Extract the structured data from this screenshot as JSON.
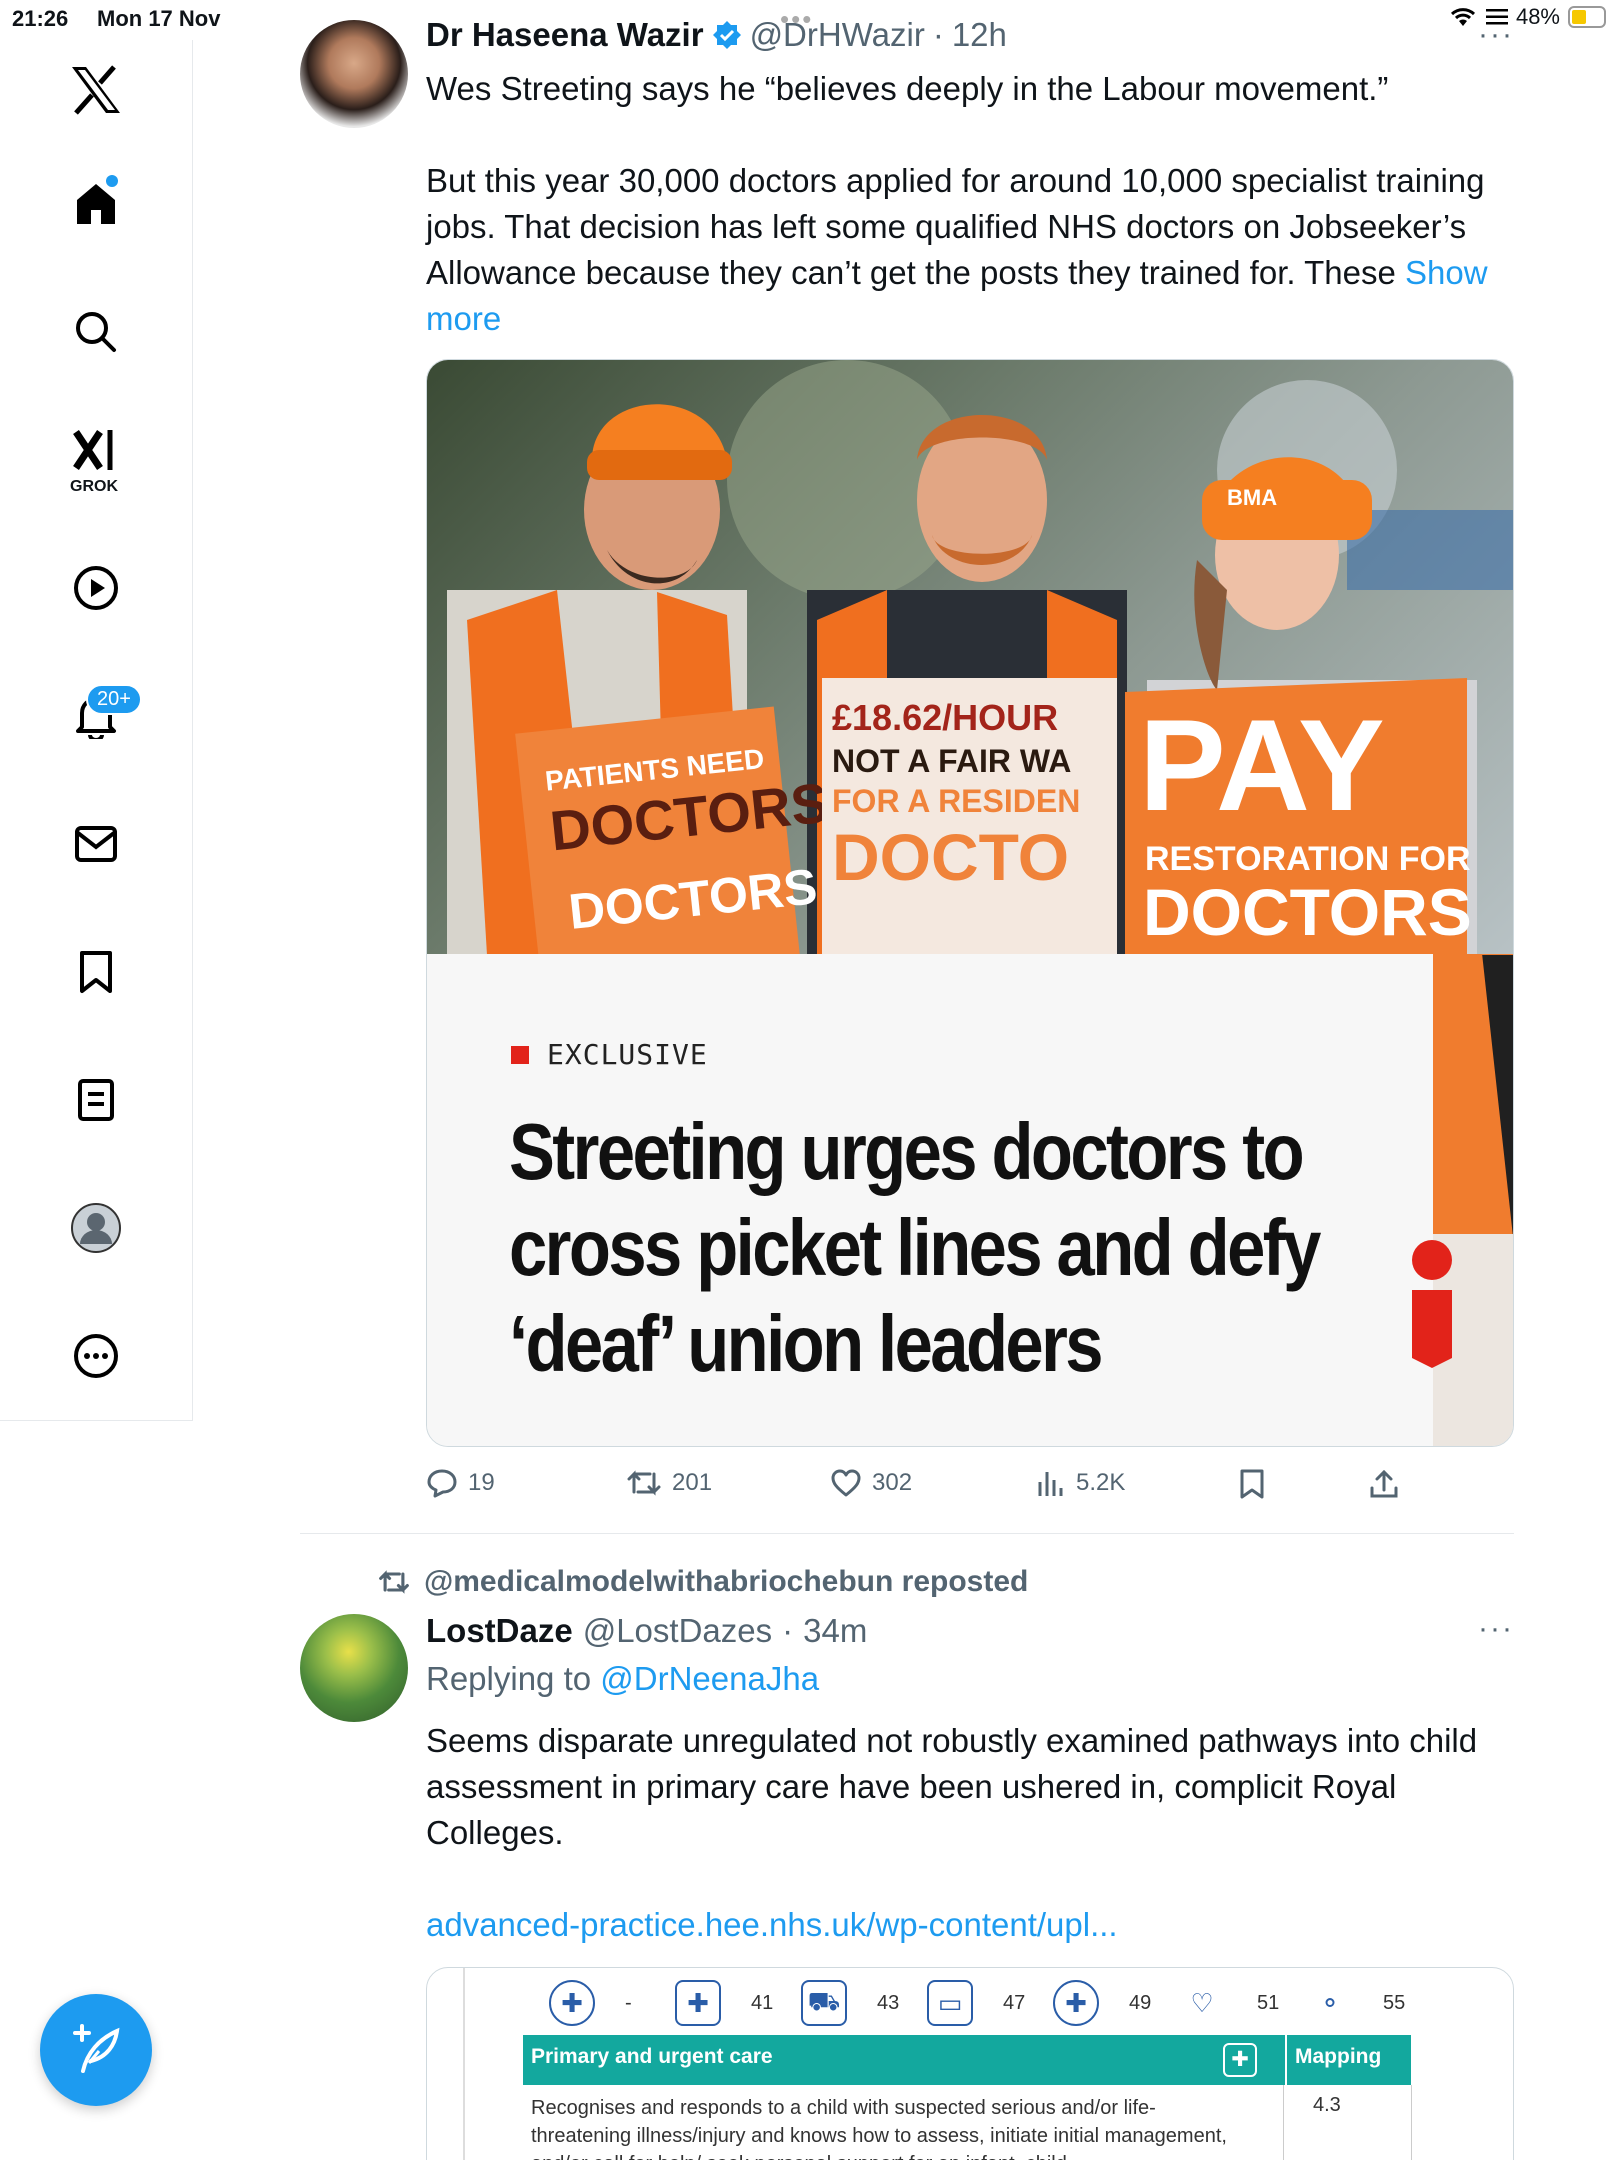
{
  "status_bar": {
    "time": "21:26",
    "date": "Mon 17 Nov",
    "battery": "48%"
  },
  "sidebar": {
    "grok_label": "GROK",
    "notifications_badge": "20+",
    "items": [
      "x-logo",
      "home",
      "search",
      "grok",
      "video",
      "notifications",
      "messages",
      "bookmarks",
      "lists",
      "profile",
      "more"
    ]
  },
  "tweet1": {
    "author": "Dr Haseena Wazir",
    "handle": "@DrHWazir",
    "sep": "·",
    "time": "12h",
    "line1": "Wes Streeting says he “believes deeply in the Labour movement.”",
    "line2": "But this year 30,000 doctors applied for around 10,000 specialist training jobs. That decision has left some qualified NHS doctors on Jobseeker’s Allowance because they can’t get the posts they trained for. These",
    "show_more": "Show more",
    "card": {
      "kicker": "EXCLUSIVE",
      "headline": "Streeting urges doctors to cross picket lines and defy ‘deaf’ union leaders",
      "signs": {
        "sign1_line1": "PATIENTS NEED",
        "sign1_line2": "DOCTORS",
        "sign1_line3": "DOCTORS",
        "sign2_line1": "£18.62/HOUR",
        "sign2_line2": "NOT A FAIR WA",
        "sign2_line3": "FOR A RESIDEN",
        "sign2_line4": "DOCTO",
        "sign3_line1": "PAY",
        "sign3_line2": "RESTORATION FOR",
        "sign3_line3": "DOCTORS",
        "hat_label": "BMA"
      }
    },
    "actions": {
      "replies": "19",
      "reposts": "201",
      "likes": "302",
      "views": "5.2K"
    }
  },
  "tweet2": {
    "repost_by": "@medicalmodelwithabriochebun reposted",
    "author": "LostDaze",
    "handle": "@LostDazes",
    "sep": "·",
    "time": "34m",
    "replying_prefix": "Replying to",
    "replying_to": "@DrNeenaJha",
    "text": "Seems disparate unregulated not robustly examined pathways into child assessment in primary care have been ushered in, complicit Royal Colleges.",
    "link": "advanced-practice.hee.nhs.uk/wp-content/upl...",
    "doc": {
      "dash": "-",
      "page_numbers": [
        "41",
        "43",
        "47",
        "49",
        "51",
        "55"
      ],
      "bar_left": "Primary and urgent care",
      "bar_right": "Mapping",
      "body": "Recognises and responds to a child with suspected serious and/or life-threatening illness/injury and knows how to assess, initiate initial management, and/or call for help/ seek personal support for an infant, child",
      "value": "4.3"
    }
  }
}
